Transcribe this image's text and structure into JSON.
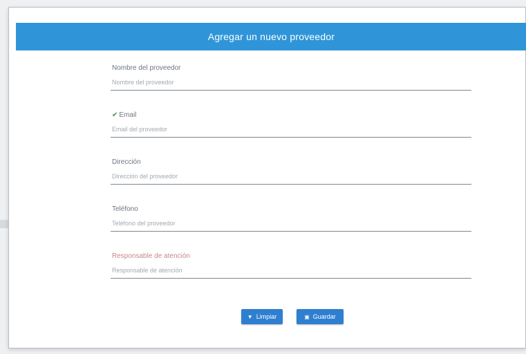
{
  "modal": {
    "title": "Agregar un nuevo proveedor"
  },
  "form": {
    "fields": [
      {
        "label": "Nombre del proveedor",
        "placeholder": "Nombre del proveedor",
        "valid": false
      },
      {
        "label": "Email",
        "placeholder": "Email del proveedor",
        "valid": true
      },
      {
        "label": "Dirección",
        "placeholder": "Dirección del proveedor",
        "valid": false
      },
      {
        "label": "Teléfono",
        "placeholder": "Teléfono del proveedor",
        "valid": false
      },
      {
        "label": "Responsable de atención",
        "placeholder": "Responsable de atención",
        "valid": false
      }
    ]
  },
  "buttons": {
    "clear_label": "Limpiar",
    "clear_icon": "filter-icon",
    "save_label": "Guardar",
    "save_icon": "floppy-disk-icon"
  },
  "colors": {
    "header": "#2f95d8",
    "button": "#2f7fd0",
    "valid_check": "#4a8f4a",
    "error_label": "#c9868a"
  }
}
